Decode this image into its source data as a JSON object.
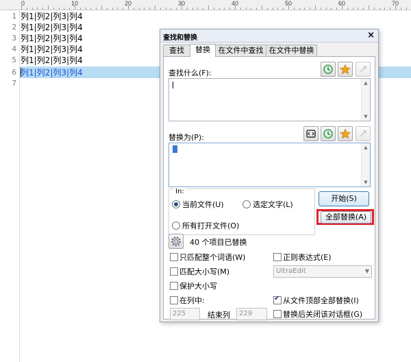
{
  "ruler": {
    "labels": [
      "0",
      "10",
      "20",
      "30",
      "40",
      "50",
      "60",
      "70"
    ]
  },
  "editor": {
    "line_numbers": [
      "1",
      "2",
      "3",
      "4",
      "5",
      "6",
      "7"
    ],
    "lines": [
      "列1|列2|列3|列4",
      "列1|列2|列3|列4",
      "列1|列2|列3|列4",
      "列1|列2|列3|列4",
      "列1|列2|列3|列4",
      "列1|列2|列3|列4",
      ""
    ],
    "highlighted_line": 6
  },
  "dialog": {
    "title": "查找和替换",
    "close_glyph": "×",
    "tabs": [
      {
        "label": "查找",
        "active": false
      },
      {
        "label": "替换",
        "active": true
      },
      {
        "label": "在文件中查找",
        "active": false
      },
      {
        "label": "在文件中替换",
        "active": false
      }
    ],
    "find_label": "查找什么(F):",
    "find_value": "",
    "replace_label": "替换为(P):",
    "replace_value": "",
    "scope": {
      "label": "In:",
      "current_file": "当前文件(U)",
      "selected_text": "选定文字(L)",
      "all_open_files": "所有打开文件(O)",
      "selected": "current_file"
    },
    "buttons": {
      "start": "开始(S)",
      "replace_all": "全部替换(A)"
    },
    "status": "40 个项目已替换",
    "options": {
      "match_whole_word": {
        "label": "只匹配整个词语(W)",
        "checked": false
      },
      "regex": {
        "label": "正则表达式(E)",
        "checked": false
      },
      "match_case": {
        "label": "匹配大小写(M)",
        "checked": false
      },
      "regex_engine": "UltraEdit",
      "preserve_case": {
        "label": "保护大小写",
        "checked": false
      },
      "in_column": {
        "label": "在列中:",
        "checked": false
      },
      "replace_all_from_top": {
        "label": "从文件顶部全部替换(I)",
        "checked": true
      },
      "start_column": "225",
      "end_column_label": "结束列",
      "end_column": "229",
      "close_after_replace": {
        "label": "替换后关闭该对话框(G)",
        "checked": false
      }
    },
    "icons": [
      "history-icon",
      "favorite-star-icon",
      "expand-icon",
      "swap-icon"
    ]
  },
  "colors": {
    "highlight": "#b8dcf4",
    "selection_text": "#1a52d6",
    "red_annotation": "#e0222b"
  }
}
